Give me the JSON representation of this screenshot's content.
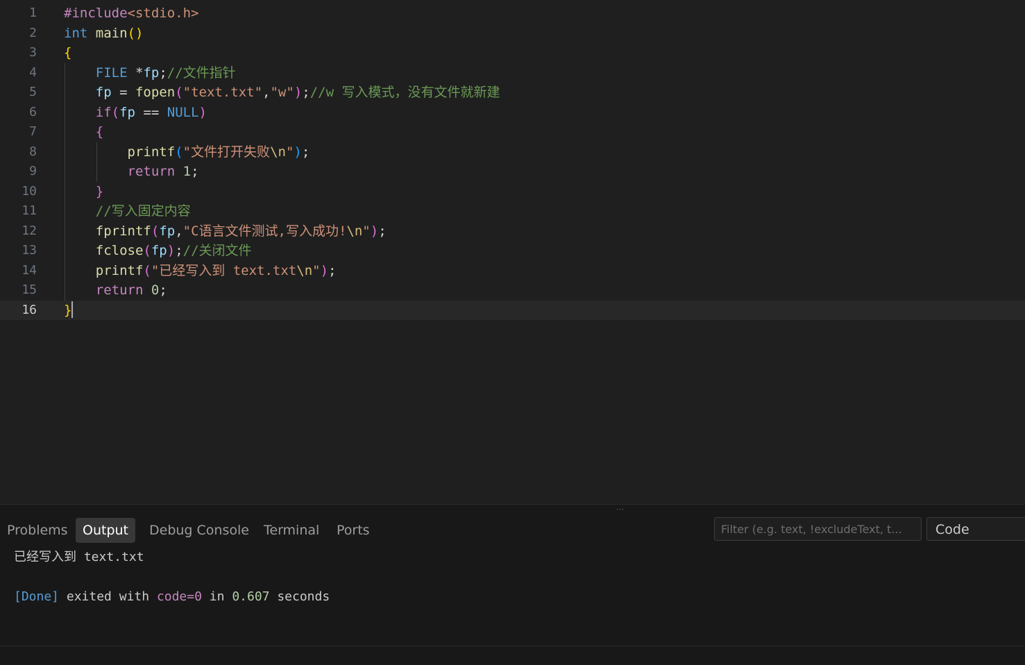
{
  "editor": {
    "line_numbers": [
      "1",
      "2",
      "3",
      "4",
      "5",
      "6",
      "7",
      "8",
      "9",
      "10",
      "11",
      "12",
      "13",
      "14",
      "15",
      "16"
    ],
    "current_line": "16",
    "lines": [
      {
        "num": "1",
        "tokens": [
          {
            "t": "#include",
            "c": "pp"
          },
          {
            "t": "<stdio.h>",
            "c": "inc"
          }
        ]
      },
      {
        "num": "2",
        "tokens": [
          {
            "t": "int",
            "c": "ty"
          },
          {
            "t": " ",
            "c": "op"
          },
          {
            "t": "main",
            "c": "fn"
          },
          {
            "t": "()",
            "c": "brace1"
          }
        ]
      },
      {
        "num": "3",
        "tokens": [
          {
            "t": "{",
            "c": "brace1"
          }
        ]
      },
      {
        "num": "4",
        "tokens": [
          {
            "t": "    ",
            "c": "op"
          },
          {
            "t": "FILE",
            "c": "ty"
          },
          {
            "t": " *",
            "c": "op"
          },
          {
            "t": "fp",
            "c": "var"
          },
          {
            "t": ";",
            "c": "op"
          },
          {
            "t": "//文件指针",
            "c": "cm"
          }
        ]
      },
      {
        "num": "5",
        "tokens": [
          {
            "t": "    ",
            "c": "op"
          },
          {
            "t": "fp",
            "c": "var"
          },
          {
            "t": " = ",
            "c": "op"
          },
          {
            "t": "fopen",
            "c": "fn"
          },
          {
            "t": "(",
            "c": "brace2"
          },
          {
            "t": "\"text.txt\"",
            "c": "str"
          },
          {
            "t": ",",
            "c": "op"
          },
          {
            "t": "\"w\"",
            "c": "str"
          },
          {
            "t": ")",
            "c": "brace2"
          },
          {
            "t": ";",
            "c": "op"
          },
          {
            "t": "//w 写入模式，没有文件就新建",
            "c": "cm"
          }
        ]
      },
      {
        "num": "6",
        "tokens": [
          {
            "t": "    ",
            "c": "op"
          },
          {
            "t": "if",
            "c": "kw"
          },
          {
            "t": "(",
            "c": "brace2"
          },
          {
            "t": "fp",
            "c": "var"
          },
          {
            "t": " == ",
            "c": "op"
          },
          {
            "t": "NULL",
            "c": "macro"
          },
          {
            "t": ")",
            "c": "brace2"
          }
        ]
      },
      {
        "num": "7",
        "tokens": [
          {
            "t": "    ",
            "c": "op"
          },
          {
            "t": "{",
            "c": "brace2"
          }
        ]
      },
      {
        "num": "8",
        "tokens": [
          {
            "t": "        ",
            "c": "op"
          },
          {
            "t": "printf",
            "c": "fn"
          },
          {
            "t": "(",
            "c": "brace3"
          },
          {
            "t": "\"文件打开失败",
            "c": "str"
          },
          {
            "t": "\\n",
            "c": "esc"
          },
          {
            "t": "\"",
            "c": "str"
          },
          {
            "t": ")",
            "c": "brace3"
          },
          {
            "t": ";",
            "c": "op"
          }
        ]
      },
      {
        "num": "9",
        "tokens": [
          {
            "t": "        ",
            "c": "op"
          },
          {
            "t": "return",
            "c": "kw"
          },
          {
            "t": " ",
            "c": "op"
          },
          {
            "t": "1",
            "c": "num"
          },
          {
            "t": ";",
            "c": "op"
          }
        ]
      },
      {
        "num": "10",
        "tokens": [
          {
            "t": "    ",
            "c": "op"
          },
          {
            "t": "}",
            "c": "brace2"
          }
        ]
      },
      {
        "num": "11",
        "tokens": [
          {
            "t": "    ",
            "c": "op"
          },
          {
            "t": "//写入固定内容",
            "c": "cm"
          }
        ]
      },
      {
        "num": "12",
        "tokens": [
          {
            "t": "    ",
            "c": "op"
          },
          {
            "t": "fprintf",
            "c": "fn"
          },
          {
            "t": "(",
            "c": "brace2"
          },
          {
            "t": "fp",
            "c": "var"
          },
          {
            "t": ",",
            "c": "op"
          },
          {
            "t": "\"C语言文件测试,写入成功!",
            "c": "str"
          },
          {
            "t": "\\n",
            "c": "esc"
          },
          {
            "t": "\"",
            "c": "str"
          },
          {
            "t": ")",
            "c": "brace2"
          },
          {
            "t": ";",
            "c": "op"
          }
        ]
      },
      {
        "num": "13",
        "tokens": [
          {
            "t": "    ",
            "c": "op"
          },
          {
            "t": "fclose",
            "c": "fn"
          },
          {
            "t": "(",
            "c": "brace2"
          },
          {
            "t": "fp",
            "c": "var"
          },
          {
            "t": ")",
            "c": "brace2"
          },
          {
            "t": ";",
            "c": "op"
          },
          {
            "t": "//关闭文件",
            "c": "cm"
          }
        ]
      },
      {
        "num": "14",
        "tokens": [
          {
            "t": "    ",
            "c": "op"
          },
          {
            "t": "printf",
            "c": "fn"
          },
          {
            "t": "(",
            "c": "brace2"
          },
          {
            "t": "\"已经写入到 text.txt",
            "c": "str"
          },
          {
            "t": "\\n",
            "c": "esc"
          },
          {
            "t": "\"",
            "c": "str"
          },
          {
            "t": ")",
            "c": "brace2"
          },
          {
            "t": ";",
            "c": "op"
          }
        ]
      },
      {
        "num": "15",
        "tokens": [
          {
            "t": "    ",
            "c": "op"
          },
          {
            "t": "return",
            "c": "kw"
          },
          {
            "t": " ",
            "c": "op"
          },
          {
            "t": "0",
            "c": "num"
          },
          {
            "t": ";",
            "c": "op"
          }
        ]
      },
      {
        "num": "16",
        "tokens": [
          {
            "t": "}",
            "c": "brace1"
          }
        ]
      }
    ]
  },
  "panel": {
    "tabs": [
      {
        "label": "Problems",
        "active": false
      },
      {
        "label": "Output",
        "active": true
      },
      {
        "label": "Debug Console",
        "active": false
      },
      {
        "label": "Terminal",
        "active": false
      },
      {
        "label": "Ports",
        "active": false
      }
    ],
    "filter_placeholder": "Filter (e.g. text, !excludeText, t...",
    "channel": "Code",
    "output": {
      "line1": "已经写入到 text.txt",
      "done": "[Done]",
      "exited": " exited with ",
      "code": "code=0",
      "in": " in ",
      "time": "0.607",
      "seconds": " seconds"
    }
  },
  "colors": {
    "editor_bg": "#1f1f1f",
    "panel_bg": "#181818",
    "keyword": "#c586c0",
    "type": "#569cd6",
    "function": "#dcdcaa",
    "string": "#ce9178",
    "comment": "#6a9955"
  }
}
